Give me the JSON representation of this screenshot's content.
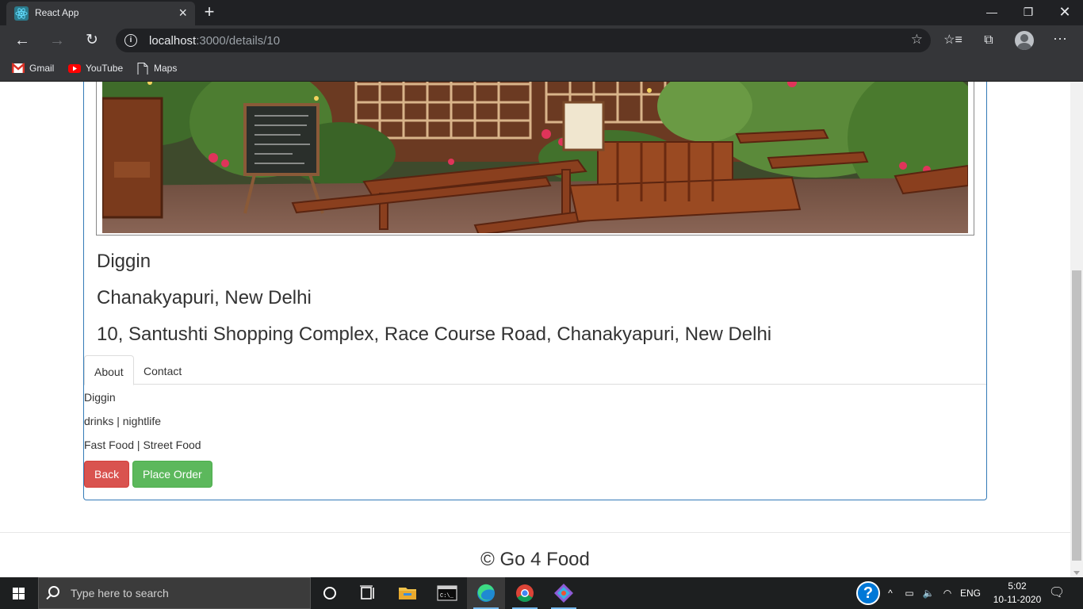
{
  "browser": {
    "tab_title": "React App",
    "url_host": "localhost",
    "url_path": ":3000/details/10",
    "bookmarks": [
      {
        "label": "Gmail",
        "icon": "gmail-icon"
      },
      {
        "label": "YouTube",
        "icon": "youtube-icon"
      },
      {
        "label": "Maps",
        "icon": "page-icon"
      }
    ]
  },
  "restaurant": {
    "name": "Diggin",
    "locality": "Chanakyapuri, New Delhi",
    "address": "10, Santushti Shopping Complex, Race Course Road, Chanakyapuri, New Delhi"
  },
  "tabs": [
    {
      "label": "About",
      "active": true
    },
    {
      "label": "Contact",
      "active": false
    }
  ],
  "about": {
    "name": "Diggin",
    "tags": "drinks | nightlife",
    "cuisines": "Fast Food | Street Food"
  },
  "buttons": {
    "back": "Back",
    "place_order": "Place Order"
  },
  "footer": {
    "text": "© Go 4 Food"
  },
  "taskbar": {
    "search_placeholder": "Type here to search",
    "language": "ENG",
    "time": "5:02",
    "date": "10-11-2020"
  },
  "colors": {
    "back_button": "#d9534f",
    "order_button": "#5cb85c",
    "panel_border": "#337ab7"
  }
}
